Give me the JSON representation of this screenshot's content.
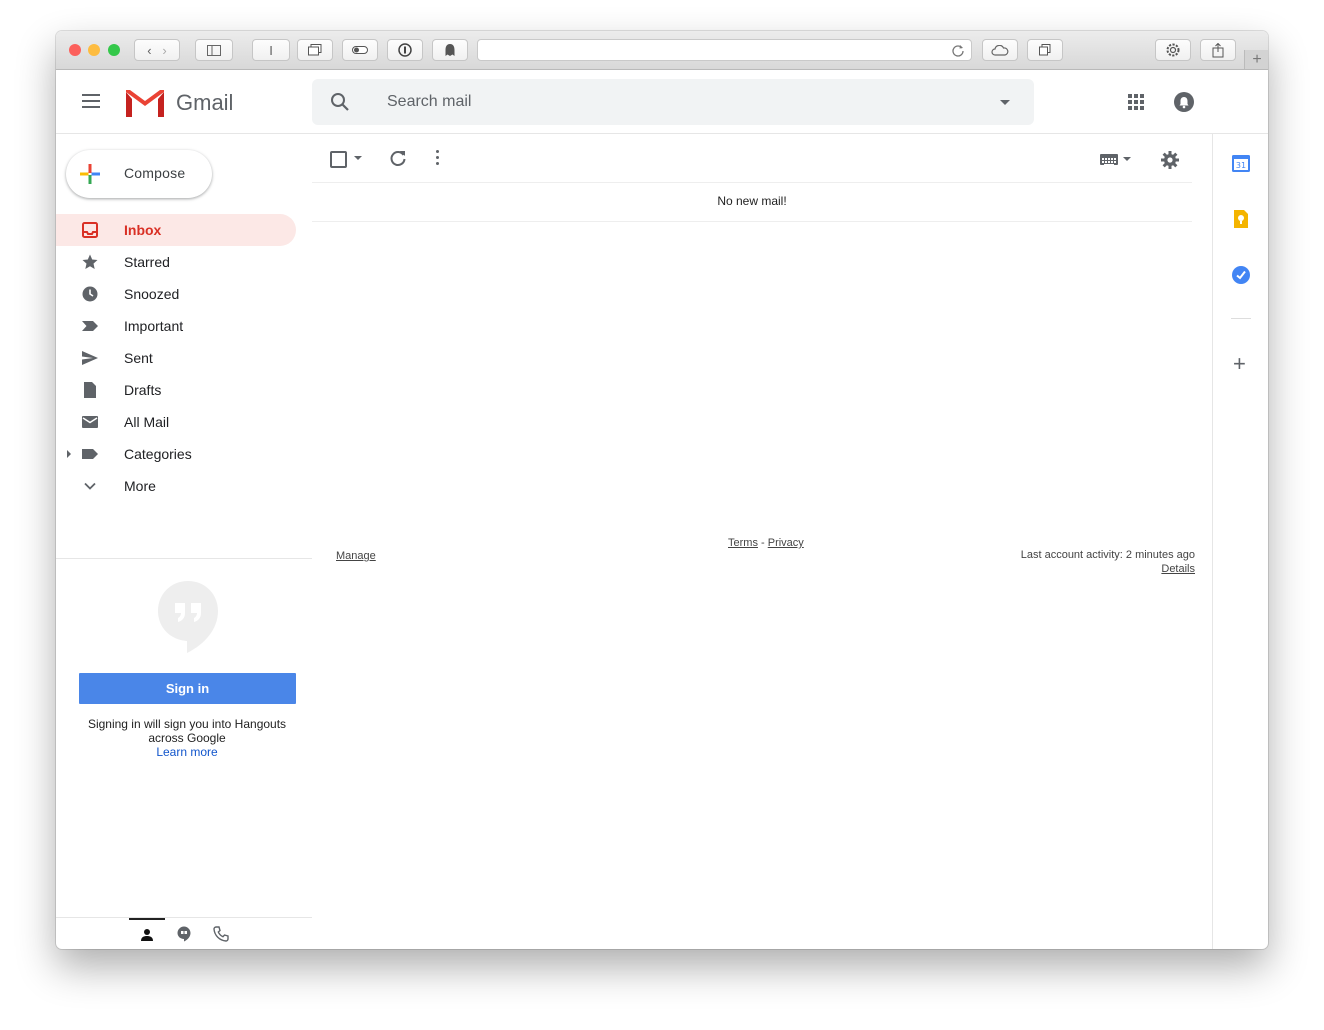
{
  "app": {
    "title": "Gmail"
  },
  "search": {
    "placeholder": "Search mail"
  },
  "compose": {
    "label": "Compose"
  },
  "nav": {
    "items": [
      {
        "label": "Inbox",
        "icon": "inbox-icon",
        "active": true
      },
      {
        "label": "Starred",
        "icon": "star-icon"
      },
      {
        "label": "Snoozed",
        "icon": "clock-icon"
      },
      {
        "label": "Important",
        "icon": "important-icon"
      },
      {
        "label": "Sent",
        "icon": "send-icon"
      },
      {
        "label": "Drafts",
        "icon": "draft-icon"
      },
      {
        "label": "All Mail",
        "icon": "mail-icon"
      },
      {
        "label": "Categories",
        "icon": "label-icon"
      },
      {
        "label": "More",
        "icon": "chevron-down-icon"
      }
    ]
  },
  "hangouts": {
    "signin_label": "Sign in",
    "signin_text": "Signing in will sign you into Hangouts across Google",
    "learn_more": "Learn more"
  },
  "main": {
    "empty_message": "No new mail!"
  },
  "footer": {
    "manage": "Manage",
    "terms": "Terms",
    "separator": " - ",
    "privacy": "Privacy",
    "activity": "Last account activity: 2 minutes ago",
    "details": "Details"
  },
  "colors": {
    "accent_red": "#d93025",
    "active_bg": "#fce8e6",
    "signin_blue": "#4a86e8",
    "calendar_blue": "#4285f4",
    "keep_yellow": "#f4b400"
  }
}
